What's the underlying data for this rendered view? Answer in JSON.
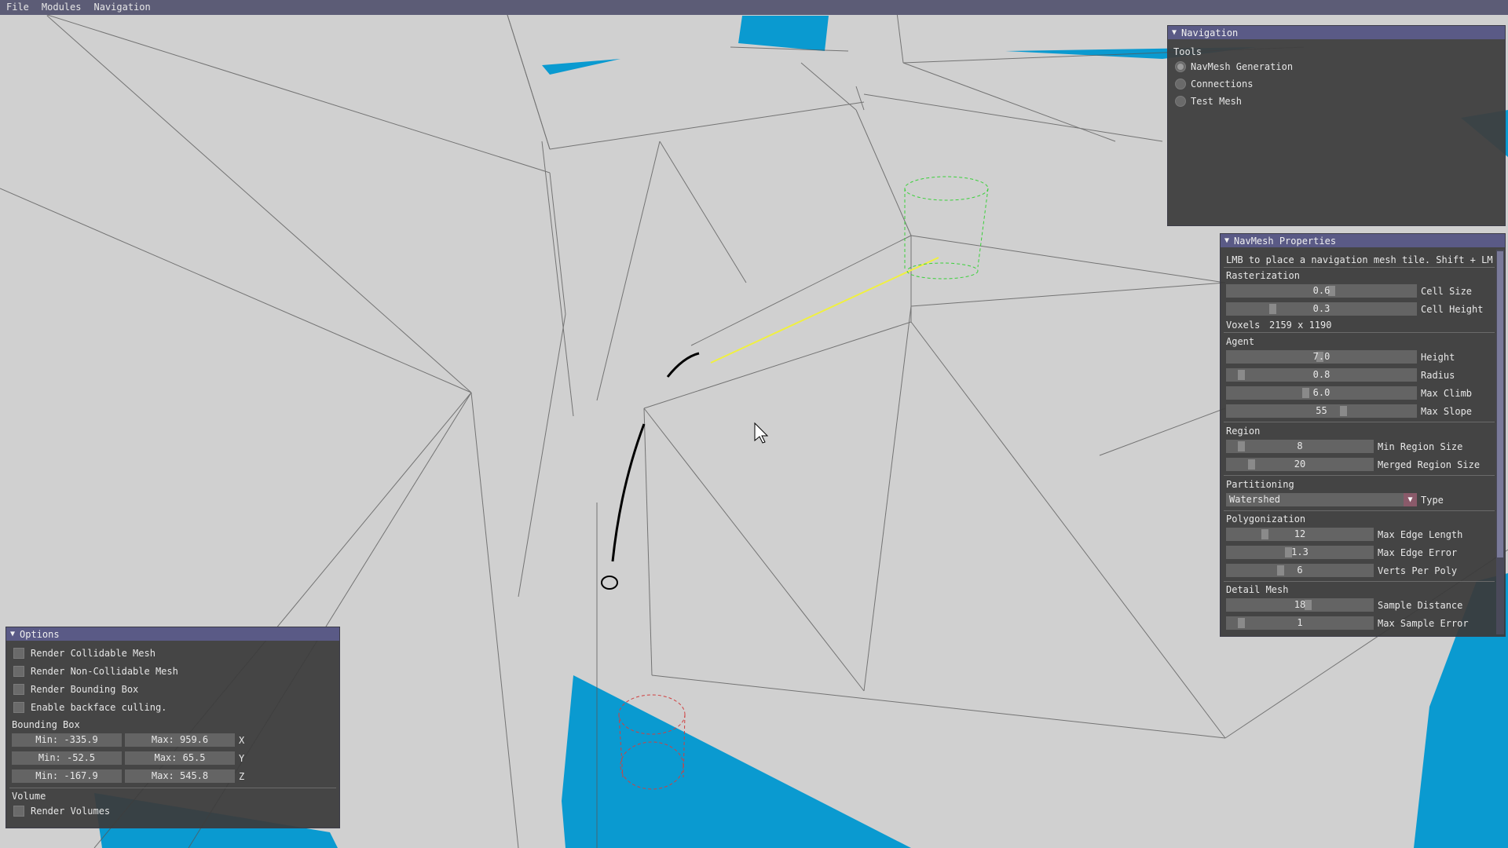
{
  "menubar": {
    "items": [
      "File",
      "Modules",
      "Navigation"
    ]
  },
  "navigation_window": {
    "title": "Navigation",
    "tools_label": "Tools",
    "tools": [
      {
        "label": "NavMesh Generation",
        "selected": true
      },
      {
        "label": "Connections",
        "selected": false
      },
      {
        "label": "Test Mesh",
        "selected": false
      }
    ]
  },
  "navmesh_properties": {
    "title": "NavMesh Properties",
    "hint": "LMB to place a navigation mesh tile. Shift + LMB",
    "rasterization": {
      "label": "Rasterization",
      "cell_size": {
        "label": "Cell Size",
        "value": "0.6"
      },
      "cell_height": {
        "label": "Cell Height",
        "value": "0.3"
      },
      "voxels_label": "Voxels",
      "voxels_value": "2159 x 1190"
    },
    "agent": {
      "label": "Agent",
      "height": {
        "label": "Height",
        "value": "7.0"
      },
      "radius": {
        "label": "Radius",
        "value": "0.8"
      },
      "max_climb": {
        "label": "Max Climb",
        "value": "6.0"
      },
      "max_slope": {
        "label": "Max Slope",
        "value": "55"
      }
    },
    "region": {
      "label": "Region",
      "min_region_size": {
        "label": "Min Region Size",
        "value": "8"
      },
      "merged_region_size": {
        "label": "Merged Region Size",
        "value": "20"
      }
    },
    "partitioning": {
      "label": "Partitioning",
      "type_value": "Watershed",
      "type_label": "Type"
    },
    "polygonization": {
      "label": "Polygonization",
      "max_edge_length": {
        "label": "Max Edge Length",
        "value": "12"
      },
      "max_edge_error": {
        "label": "Max Edge Error",
        "value": "1.3"
      },
      "verts_per_poly": {
        "label": "Verts Per Poly",
        "value": "6"
      }
    },
    "detail_mesh": {
      "label": "Detail Mesh",
      "sample_distance": {
        "label": "Sample Distance",
        "value": "18"
      },
      "max_sample_error": {
        "label": "Max Sample Error",
        "value": "1"
      }
    }
  },
  "options_window": {
    "title": "Options",
    "checkboxes": [
      "Render Collidable Mesh",
      "Render Non-Collidable Mesh",
      "Render Bounding Box",
      "Enable backface culling."
    ],
    "bounding_box": {
      "label": "Bounding Box",
      "x": {
        "min": "Min: -335.9",
        "max": "Max: 959.6",
        "axis": "X"
      },
      "y": {
        "min": "Min: -52.5",
        "max": "Max: 65.5",
        "axis": "Y"
      },
      "z": {
        "min": "Min: -167.9",
        "max": "Max: 545.8",
        "axis": "Z"
      }
    },
    "volume_label": "Volume",
    "render_volumes": "Render Volumes"
  },
  "colors": {
    "background": "#d0d0d0",
    "water": "#0a9ad0",
    "title_bar": "#5a5a86",
    "menu_bar": "#5c5c76"
  }
}
